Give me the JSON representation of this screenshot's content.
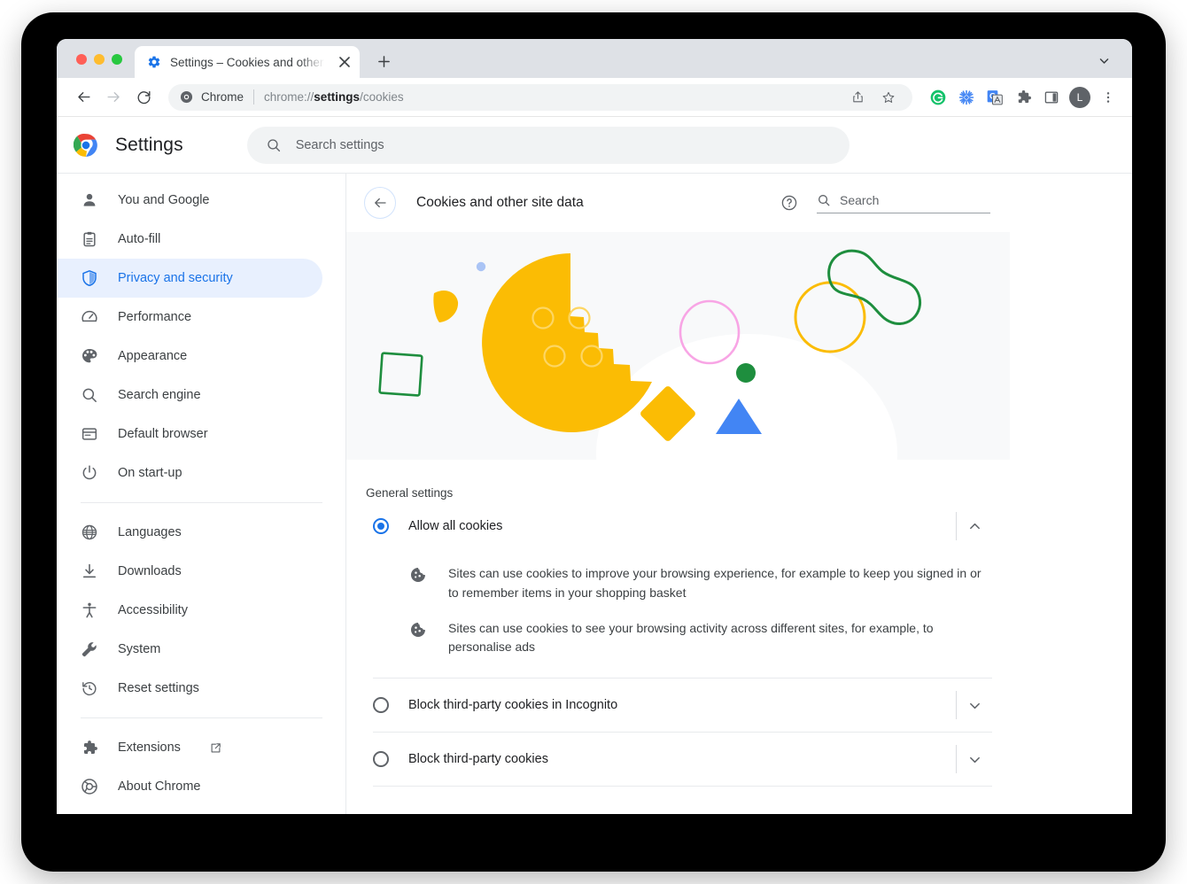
{
  "browser": {
    "tab": {
      "favicon": "gear-icon",
      "title": "Settings – Cookies and other si",
      "close_label": "×"
    },
    "new_tab_label": "+",
    "tablist_chevron": "chevron-down-icon",
    "nav": {
      "back": "back-arrow-icon",
      "forward": "forward-arrow-icon",
      "reload": "reload-icon"
    },
    "omnibox": {
      "site_icon": "chrome-icon",
      "site_label": "Chrome",
      "url_prefix": "chrome://",
      "url_bold": "settings",
      "url_suffix": "/cookies",
      "share_icon": "share-icon",
      "bookmark_icon": "star-icon"
    },
    "extensions": [
      {
        "name": "grammarly-extension-icon",
        "glyph": "G",
        "color": "#15c26b"
      },
      {
        "name": "asterisk-extension-icon",
        "glyph": "",
        "color": "#4285f4"
      },
      {
        "name": "google-translate-extension-icon",
        "glyph": "G",
        "color": "#4285f4"
      },
      {
        "name": "extensions-puzzle-icon",
        "glyph": "",
        "color": "#5f6368"
      },
      {
        "name": "side-panel-icon",
        "glyph": "",
        "color": "#5f6368"
      }
    ],
    "avatar_letter": "L",
    "menu_icon": "three-dot-menu-icon"
  },
  "settings": {
    "logo": "chrome-logo",
    "title": "Settings",
    "search_placeholder": "Search settings"
  },
  "sidebar": {
    "groups": [
      {
        "items": [
          {
            "icon": "person-icon",
            "label": "You and Google",
            "active": false
          },
          {
            "icon": "clipboard-icon",
            "label": "Auto-fill",
            "active": false
          },
          {
            "icon": "shield-icon",
            "label": "Privacy and security",
            "active": true
          },
          {
            "icon": "speedometer-icon",
            "label": "Performance",
            "active": false
          },
          {
            "icon": "palette-icon",
            "label": "Appearance",
            "active": false
          },
          {
            "icon": "search-icon",
            "label": "Search engine",
            "active": false
          },
          {
            "icon": "browser-window-icon",
            "label": "Default browser",
            "active": false
          },
          {
            "icon": "power-icon",
            "label": "On start-up",
            "active": false
          }
        ]
      },
      {
        "items": [
          {
            "icon": "globe-icon",
            "label": "Languages",
            "active": false
          },
          {
            "icon": "download-icon",
            "label": "Downloads",
            "active": false
          },
          {
            "icon": "accessibility-icon",
            "label": "Accessibility",
            "active": false
          },
          {
            "icon": "wrench-icon",
            "label": "System",
            "active": false
          },
          {
            "icon": "history-restore-icon",
            "label": "Reset settings",
            "active": false
          }
        ]
      },
      {
        "items": [
          {
            "icon": "puzzle-icon",
            "label": "Extensions",
            "active": false,
            "external": true
          },
          {
            "icon": "chrome-circle-icon",
            "label": "About Chrome",
            "active": false
          }
        ]
      }
    ]
  },
  "page": {
    "back_icon": "back-arrow-icon",
    "title": "Cookies and other site data",
    "help_icon": "help-circle-icon",
    "search_icon": "search-icon",
    "search_placeholder": "Search",
    "illustration_name": "cookie-illustration",
    "section_label": "General settings",
    "options": [
      {
        "id": "allow-all-cookies",
        "label": "Allow all cookies",
        "checked": true,
        "expanded": true,
        "chevron": "chevron-up-icon",
        "descriptions": [
          {
            "icon": "cookie-icon",
            "text": "Sites can use cookies to improve your browsing experience, for example to keep you signed in or to remember items in your shopping basket"
          },
          {
            "icon": "cookie-icon",
            "text": "Sites can use cookies to see your browsing activity across different sites, for example, to personalise ads"
          }
        ]
      },
      {
        "id": "block-third-party-incognito",
        "label": "Block third-party cookies in Incognito",
        "checked": false,
        "expanded": false,
        "chevron": "chevron-down-icon",
        "descriptions": []
      },
      {
        "id": "block-third-party",
        "label": "Block third-party cookies",
        "checked": false,
        "expanded": false,
        "chevron": "chevron-down-icon",
        "descriptions": []
      }
    ]
  },
  "colors": {
    "accent_blue": "#1a73e8",
    "cookie_yellow": "#fbbc04",
    "green": "#1e8e3e",
    "pink": "#f8a5e5",
    "blue": "#4285f4",
    "sidebar_active_bg": "#e8f0fe",
    "illustration_bg": "#f8f9fa"
  }
}
